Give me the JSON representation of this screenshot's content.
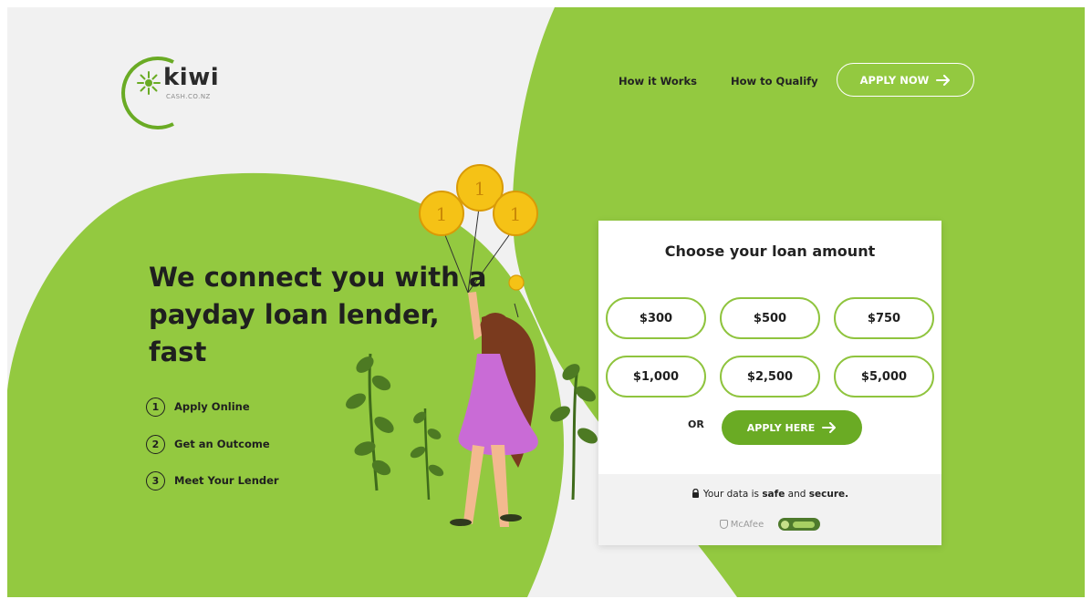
{
  "brand": {
    "name": "kiwi",
    "domain": "CASH.CO.NZ",
    "accent_color": "#8fc43e",
    "dark_green": "#6aab24"
  },
  "nav": {
    "how_it_works": "How it Works",
    "how_to_qualify": "How to Qualify",
    "apply_now": "APPLY NOW",
    "apply_now_icon": "arrow-right-icon"
  },
  "hero": {
    "headline_lines": [
      "We connect you with a",
      "payday loan lender,",
      "fast"
    ],
    "steps": [
      {
        "num": "1",
        "label": "Apply Online"
      },
      {
        "num": "2",
        "label": "Get an Outcome"
      },
      {
        "num": "3",
        "label": "Meet Your Lender"
      }
    ],
    "coin_mark": "1"
  },
  "loan_card": {
    "title": "Choose your loan amount",
    "amounts": [
      "$300",
      "$500",
      "$750",
      "$1,000",
      "$2,500",
      "$5,000"
    ],
    "or_label": "OR",
    "apply_here": "APPLY HERE",
    "secure_prefix": "Your data is ",
    "secure_safe": "safe",
    "secure_and": " and ",
    "secure_secure": "secure.",
    "lock_icon": "lock-icon",
    "badge_mcafee": "McAfee",
    "badge_secure_icon": "secure-badge-icon"
  }
}
